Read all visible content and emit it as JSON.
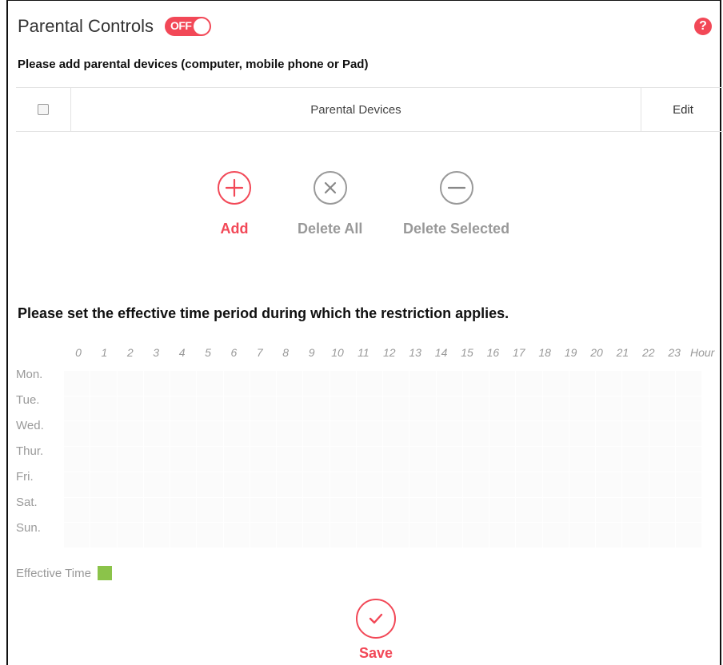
{
  "header": {
    "title": "Parental Controls",
    "toggle_label": "OFF",
    "help_icon": "question-mark-icon",
    "help_glyph": "?"
  },
  "devices": {
    "instruction": "Please add parental devices (computer, mobile phone or Pad)",
    "columns": [
      "",
      "Parental Devices",
      "Edit"
    ],
    "rows": []
  },
  "actions": {
    "add_label": "Add",
    "delete_all_label": "Delete All",
    "delete_selected_label": "Delete Selected"
  },
  "schedule": {
    "instruction": "Please set the effective time period during which the restriction applies.",
    "hours": [
      "0",
      "1",
      "2",
      "3",
      "4",
      "5",
      "6",
      "7",
      "8",
      "9",
      "10",
      "11",
      "12",
      "13",
      "14",
      "15",
      "16",
      "17",
      "18",
      "19",
      "20",
      "21",
      "22",
      "23"
    ],
    "hour_unit": "Hour",
    "days": [
      "Mon.",
      "Tue.",
      "Wed.",
      "Thur.",
      "Fri.",
      "Sat.",
      "Sun."
    ],
    "legend_label": "Effective Time"
  },
  "save_label": "Save",
  "colors": {
    "accent": "#f24857",
    "effective_time": "#8bc34a",
    "muted": "#999999"
  }
}
